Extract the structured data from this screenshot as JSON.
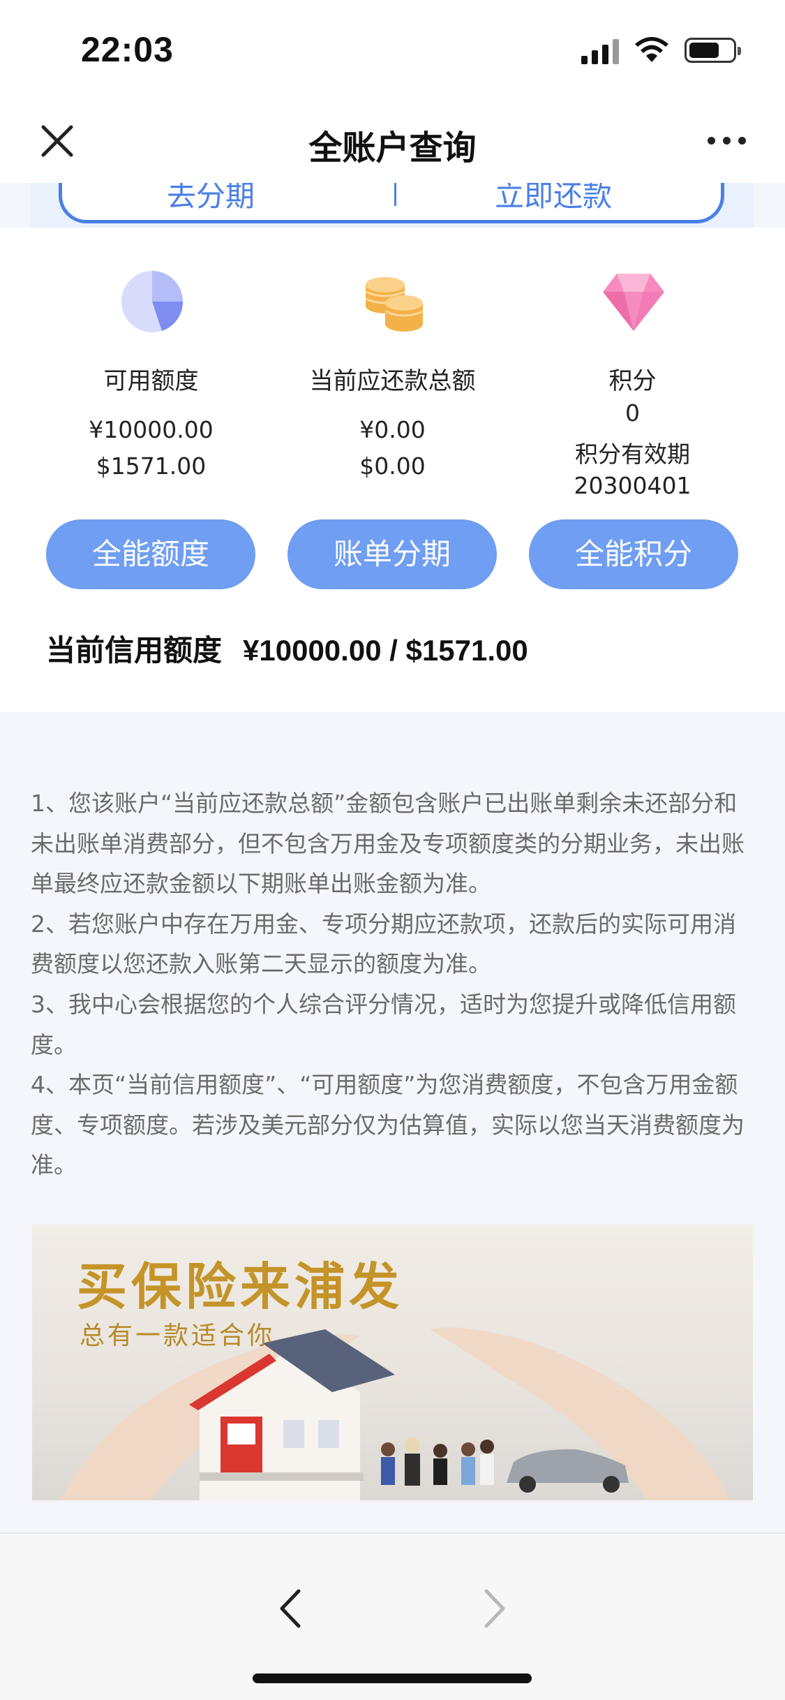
{
  "status_bar": {
    "time": "22:03"
  },
  "nav": {
    "title": "全账户查询"
  },
  "top_card": {
    "left_button": "去分期",
    "right_button": "立即还款"
  },
  "summary": {
    "columns": [
      {
        "icon": "pie-chart-icon",
        "label": "可用额度",
        "line1": "¥10000.00",
        "line2": "$1571.00",
        "button": "全能额度"
      },
      {
        "icon": "coins-icon",
        "label": "当前应还款总额",
        "line1": "¥0.00",
        "line2": "$0.00",
        "button": "账单分期"
      },
      {
        "icon": "diamond-icon",
        "label": "积分",
        "line1": "0",
        "line2": "积分有效期",
        "line3": "20300401",
        "button": "全能积分"
      }
    ],
    "credit_label": "当前信用额度",
    "credit_value": "¥10000.00 / $1571.00"
  },
  "notes": [
    "1、您该账户“当前应还款总额”金额包含账户已出账单剩余未还部分和未出账单消费部分，但不包含万用金及专项额度类的分期业务，未出账单最终应还款金额以下期账单出账金额为准。",
    "2、若您账户中存在万用金、专项分期应还款项，还款后的实际可用消费额度以您还款入账第二天显示的额度为准。",
    "3、我中心会根据您的个人综合评分情况，适时为您提升或降低信用额度。",
    "4、本页“当前信用额度”、“可用额度”为您消费额度，不包含万用金额度、专项额度。若涉及美元部分仅为估算值，实际以您当天消费额度为准。"
  ],
  "banner": {
    "title": "买保险来浦发",
    "subtitle": "总有一款适合你"
  },
  "colors": {
    "accent": "#4a7fe6",
    "pill": "#6f9ef2",
    "banner_gold": "#c49428"
  }
}
